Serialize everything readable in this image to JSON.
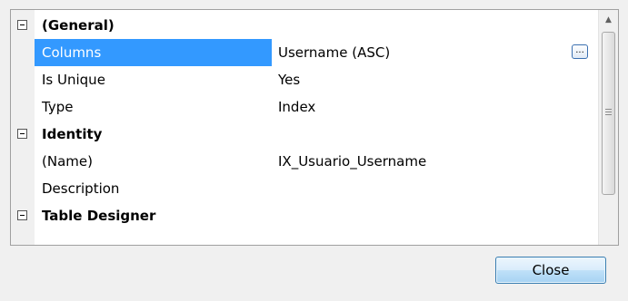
{
  "property_grid": {
    "categories": [
      {
        "label": "(General)",
        "properties": [
          {
            "name": "Columns",
            "value": "Username (ASC)",
            "has_ellipsis": true,
            "selected": true
          },
          {
            "name": "Is Unique",
            "value": "Yes"
          },
          {
            "name": "Type",
            "value": "Index"
          }
        ]
      },
      {
        "label": "Identity",
        "properties": [
          {
            "name": "(Name)",
            "value": "IX_Usuario_Username"
          },
          {
            "name": "Description",
            "value": ""
          }
        ]
      },
      {
        "label": "Table Designer",
        "properties": []
      }
    ],
    "ellipsis_label": "...",
    "collapse_icon": "minus-box-icon",
    "scroll_up_icon": "▲"
  },
  "footer": {
    "close_label": "Close"
  },
  "colors": {
    "selection": "#3399ff",
    "gutter": "#f0f0f0",
    "button_border": "#3c7fb1"
  }
}
